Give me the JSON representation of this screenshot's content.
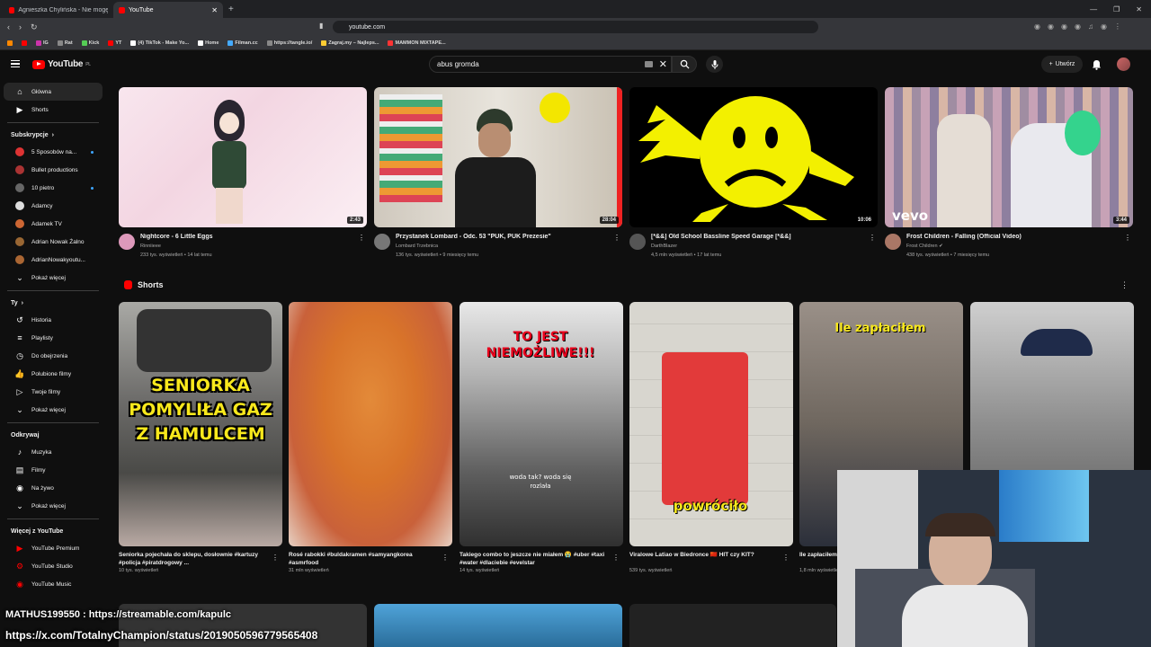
{
  "browser": {
    "tabs": [
      {
        "label": "Agnieszka Chylińska - Nie mogę Ci"
      },
      {
        "label": "YouTube"
      }
    ],
    "url": "youtube.com",
    "bookmarks": [
      "IG",
      "Rat",
      "Kick",
      "YT",
      "(4) TikTok - Make Yo...",
      "Home",
      "Filman.cc",
      "https://tangle.io/",
      "Zagraj.my – Najleps...",
      "MAMMON MIXTAPE..."
    ]
  },
  "youtube": {
    "logo_text": "YouTube",
    "logo_region": "PL",
    "search_value": "abus gromda",
    "create_label": "Utwórz"
  },
  "sidebar": {
    "main": [
      {
        "label": "Główna",
        "icon": "home-icon"
      },
      {
        "label": "Shorts",
        "icon": "shorts-icon"
      }
    ],
    "subs_heading": "Subskrypcje",
    "subscriptions": [
      {
        "label": "5 Sposobów na...",
        "color": "#d33",
        "dot": true
      },
      {
        "label": "Bullet productions",
        "color": "#a33",
        "dot": false
      },
      {
        "label": "10 pietro",
        "color": "#666",
        "dot": true
      },
      {
        "label": "Adamcy",
        "color": "#ddd",
        "dot": false
      },
      {
        "label": "Adamek TV",
        "color": "#c63",
        "dot": false
      },
      {
        "label": "Adrian Nowak Żalno",
        "color": "#963",
        "dot": false
      },
      {
        "label": "AdrianNowakyoutu...",
        "color": "#a63",
        "dot": false
      }
    ],
    "subs_more": "Pokaż więcej",
    "you_heading": "Ty",
    "you": [
      {
        "label": "Historia",
        "icon": "history-icon"
      },
      {
        "label": "Playlisty",
        "icon": "playlist-icon"
      },
      {
        "label": "Do obejrzenia",
        "icon": "watch-later-icon"
      },
      {
        "label": "Polubione filmy",
        "icon": "like-icon"
      },
      {
        "label": "Twoje filmy",
        "icon": "your-videos-icon"
      }
    ],
    "you_more": "Pokaż więcej",
    "explore_heading": "Odkrywaj",
    "explore": [
      {
        "label": "Muzyka",
        "icon": "music-icon"
      },
      {
        "label": "Filmy",
        "icon": "film-icon"
      },
      {
        "label": "Na żywo",
        "icon": "live-icon"
      }
    ],
    "explore_more": "Pokaż więcej",
    "more_heading": "Więcej z YouTube",
    "more": [
      {
        "label": "YouTube Premium"
      },
      {
        "label": "YouTube Studio"
      },
      {
        "label": "YouTube Music"
      }
    ]
  },
  "videos": [
    {
      "title": "Nightcore - 6 Little Eggs",
      "channel": "Rinniieee",
      "meta": "233 tys. wyświetleń • 14 lat temu",
      "duration": "2:43"
    },
    {
      "title": "Przystanek Lombard - Odc. 53 \"PUK, PUK Prezesie\"",
      "channel": "Lombard Trzebnica",
      "meta": "136 tys. wyświetleń • 9 miesięcy temu",
      "duration": "28:04"
    },
    {
      "title": "[*&&] Old School Bassline Speed Garage [*&&]",
      "channel": "DarthBlazer",
      "meta": "4,5 mln wyświetleń • 17 lat temu",
      "duration": "10:06"
    },
    {
      "title": "Frost Children - Falling (Official Video)",
      "channel": "Frost Children",
      "meta": "438 tys. wyświetleń • 7 miesięcy temu",
      "duration": "3:44",
      "badge": "vevo"
    }
  ],
  "shorts_heading": "Shorts",
  "shorts": [
    {
      "title": "Seniorka pojechała do sklepu, dosłownie #kartuzy #policja #piratdrogowy ...",
      "views": "10 tys. wyświetleń",
      "overlay": "SENIORKA POMYLIŁA GAZ Z HAMULCEM"
    },
    {
      "title": "Rosé rabokki #buldakramen #samyangkorea #asmrfood",
      "views": "31 mln wyświetleń",
      "overlay": ""
    },
    {
      "title": "Takiego combo to jeszcze nie miałem 😭 #uber #taxi #water #dlaciebie #evelstar",
      "views": "14 tys. wyświetleń",
      "overlay": "TO JEST NIEMOŻLIWE!!!",
      "caption": "woda tak? woda się rozlała"
    },
    {
      "title": "Viralowe Latiao w Biedronce 🇨🇳 HIT czy KIT?",
      "views": "539 tys. wyświetleń",
      "overlay": "powróciło"
    },
    {
      "title": "Ile zapłaciłem...",
      "views": "1,8 mln wyświetleń",
      "overlay": "Ile zapłaciłem"
    },
    {
      "title": "",
      "views": "",
      "overlay": ""
    }
  ],
  "stream_overlay": {
    "line1": "MATHUS199550 : https://streamable.com/kapulc",
    "line2": "https://x.com/TotalnyChampion/status/2019050596779565408"
  }
}
